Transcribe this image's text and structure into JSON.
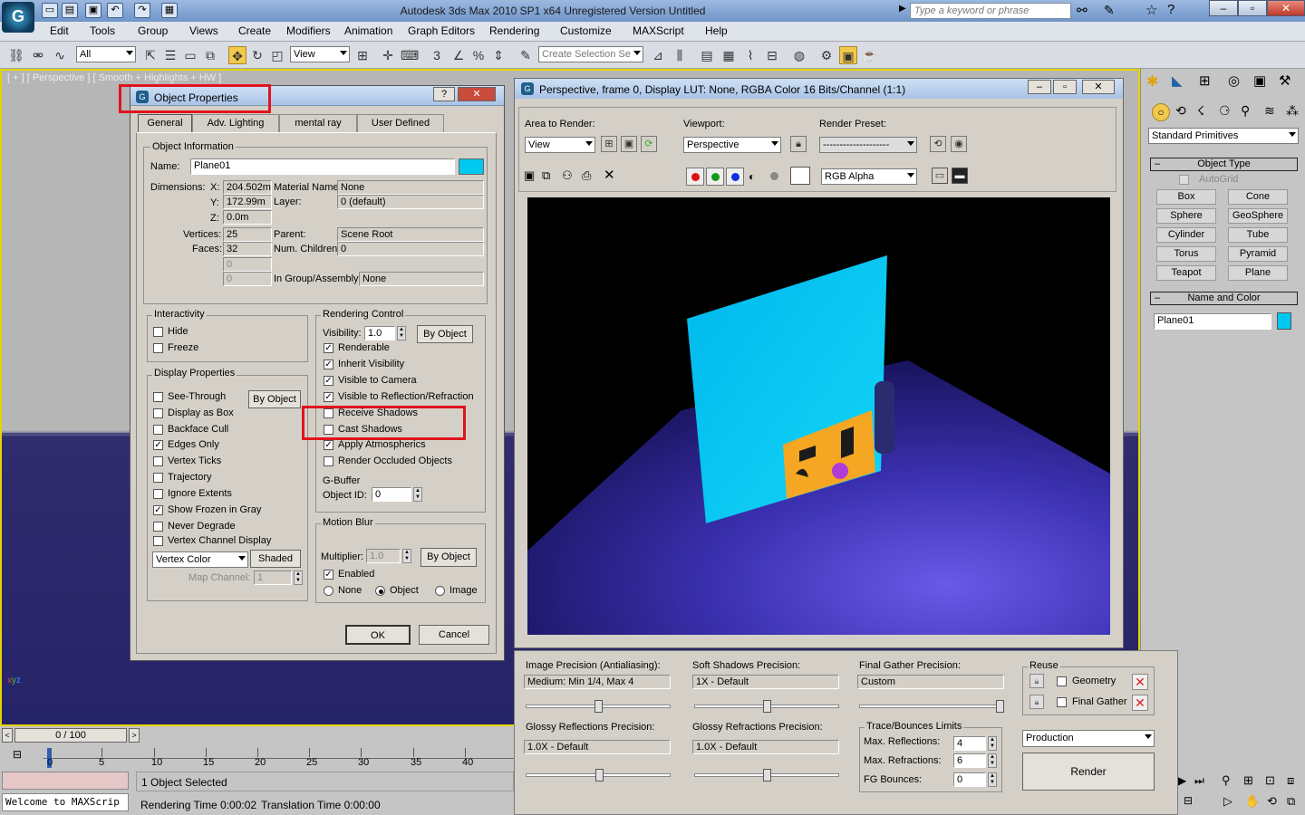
{
  "window": {
    "title": "Autodesk 3ds Max  2010 SP1 x64    Unregistered Version      Untitled",
    "search_placeholder": "Type a keyword or phrase"
  },
  "menu": [
    "Edit",
    "Tools",
    "Group",
    "Views",
    "Create",
    "Modifiers",
    "Animation",
    "Graph Editors",
    "Rendering",
    "Customize",
    "MAXScript",
    "Help"
  ],
  "toolbar": {
    "selection_filter": "All",
    "ref_coord": "View",
    "named_selection": "Create Selection Se"
  },
  "viewport": {
    "label": "[ + ] [ Perspective ] [ Smooth + Highlights + HW ]"
  },
  "object_properties": {
    "title": "Object Properties",
    "help_button": "?",
    "close_button": "✕",
    "tabs": [
      "General",
      "Adv. Lighting",
      "mental ray",
      "User Defined"
    ],
    "object_info": {
      "group_label": "Object Information",
      "name_label": "Name:",
      "name_value": "Plane01",
      "color": "#00c8f0",
      "dimensions_label": "Dimensions:",
      "x_label": "X:",
      "x_value": "204.502m",
      "y_label": "Y:",
      "y_value": "172.99m",
      "z_label": "Z:",
      "z_value": "0.0m",
      "vertices_label": "Vertices:",
      "vertices_value": "25",
      "faces_label": "Faces:",
      "faces_value": "32",
      "blank1": "0",
      "blank2": "0",
      "material_label": "Material Name:",
      "material_value": "None",
      "layer_label": "Layer:",
      "layer_value": "0 (default)",
      "parent_label": "Parent:",
      "parent_value": "Scene Root",
      "children_label": "Num. Children:",
      "children_value": "0",
      "group_assembly_label": "In Group/Assembly:",
      "group_assembly_value": "None"
    },
    "interactivity": {
      "label": "Interactivity",
      "hide": "Hide",
      "freeze": "Freeze"
    },
    "display_properties": {
      "label": "Display Properties",
      "by_object": "By Object",
      "items": [
        {
          "label": "See-Through",
          "checked": false
        },
        {
          "label": "Display as Box",
          "checked": false
        },
        {
          "label": "Backface Cull",
          "checked": false
        },
        {
          "label": "Edges Only",
          "checked": true
        },
        {
          "label": "Vertex Ticks",
          "checked": false
        },
        {
          "label": "Trajectory",
          "checked": false
        },
        {
          "label": "Ignore Extents",
          "checked": false
        },
        {
          "label": "Show Frozen in Gray",
          "checked": true
        },
        {
          "label": "Never Degrade",
          "checked": false
        },
        {
          "label": "Vertex Channel Display",
          "checked": false
        }
      ],
      "vertex_color": "Vertex Color",
      "shaded": "Shaded",
      "map_channel_label": "Map Channel:",
      "map_channel_value": "1"
    },
    "rendering_control": {
      "label": "Rendering Control",
      "visibility_label": "Visibility:",
      "visibility_value": "1.0",
      "by_object": "By Object",
      "items": [
        {
          "label": "Renderable",
          "checked": true
        },
        {
          "label": "Inherit Visibility",
          "checked": true
        },
        {
          "label": "Visible to Camera",
          "checked": true
        },
        {
          "label": "Visible to Reflection/Refraction",
          "checked": true
        },
        {
          "label": "Receive Shadows",
          "checked": false
        },
        {
          "label": "Cast Shadows",
          "checked": false
        },
        {
          "label": "Apply Atmospherics",
          "checked": true
        },
        {
          "label": "Render Occluded Objects",
          "checked": false
        }
      ]
    },
    "gbuffer": {
      "label": "G-Buffer",
      "object_id_label": "Object ID:",
      "object_id_value": "0"
    },
    "motion_blur": {
      "label": "Motion Blur",
      "multiplier_label": "Multiplier:",
      "multiplier_value": "1.0",
      "by_object": "By Object",
      "enabled": "Enabled",
      "none": "None",
      "object": "Object",
      "image": "Image"
    },
    "ok": "OK",
    "cancel": "Cancel"
  },
  "render_window": {
    "title": "Perspective, frame 0, Display LUT: None, RGBA Color 16 Bits/Channel (1:1)",
    "area_label": "Area to Render:",
    "area_value": "View",
    "viewport_label": "Viewport:",
    "viewport_value": "Perspective",
    "preset_label": "Render Preset:",
    "preset_value": "--------------------",
    "channel_value": "RGB Alpha"
  },
  "render_options": {
    "image_precision_label": "Image Precision (Antialiasing):",
    "image_precision_value": "Medium: Min 1/4, Max 4",
    "soft_shadows_label": "Soft Shadows Precision:",
    "soft_shadows_value": "1X - Default",
    "final_gather_label": "Final Gather Precision:",
    "final_gather_value": "Custom",
    "glossy_reflections_label": "Glossy Reflections Precision:",
    "glossy_reflections_value": "1.0X - Default",
    "glossy_refractions_label": "Glossy Refractions Precision:",
    "glossy_refractions_value": "1.0X - Default",
    "trace_label": "Trace/Bounces Limits",
    "max_reflections_label": "Max. Reflections:",
    "max_reflections_value": "4",
    "max_refractions_label": "Max. Refractions:",
    "max_refractions_value": "6",
    "fg_bounces_label": "FG Bounces:",
    "fg_bounces_value": "0",
    "reuse_label": "Reuse",
    "geometry": "Geometry",
    "final_gather": "Final Gather",
    "production": "Production",
    "render": "Render"
  },
  "command_panel": {
    "category": "Standard Primitives",
    "object_type_label": "Object Type",
    "autogrid": "AutoGrid",
    "buttons": [
      "Box",
      "Cone",
      "Sphere",
      "GeoSphere",
      "Cylinder",
      "Tube",
      "Torus",
      "Pyramid",
      "Teapot",
      "Plane"
    ],
    "name_color_label": "Name and Color",
    "name_value": "Plane01",
    "color": "#00c8f0"
  },
  "timeline": {
    "frame": "0 / 100",
    "ticks": [
      "0",
      "5",
      "10",
      "15",
      "20",
      "25",
      "30",
      "35",
      "40"
    ]
  },
  "status": {
    "script": "Welcome to MAXScrip",
    "selected": "1 Object Selected",
    "render_time": "Rendering Time  0:00:02",
    "translation_time": "Translation Time  0:00:00"
  }
}
